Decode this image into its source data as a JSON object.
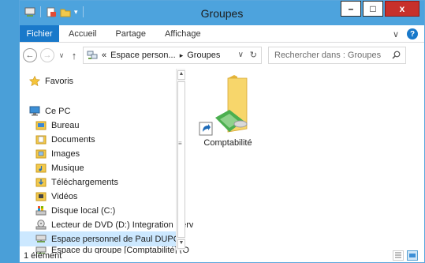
{
  "window": {
    "title": "Groupes",
    "controls": {
      "minimize": "–",
      "maximize": "□",
      "close": "x"
    }
  },
  "ribbon": {
    "file_tab": "Fichier",
    "tabs": [
      "Accueil",
      "Partage",
      "Affichage"
    ],
    "expand_glyph": "∨",
    "help_glyph": "?"
  },
  "address_bar": {
    "back_glyph": "←",
    "forward_glyph": "→",
    "history_glyph": "∨",
    "up_glyph": "↑",
    "overflow": "«",
    "segments": [
      "Espace person...",
      "Groupes"
    ],
    "separator": "▸",
    "dropdown_glyph": "∨",
    "refresh_glyph": "↻"
  },
  "search": {
    "placeholder": "Rechercher dans : Groupes"
  },
  "nav_pane": {
    "items": [
      {
        "label": "Favoris",
        "icon": "star-icon"
      },
      {
        "label": "Ce PC",
        "icon": "computer-icon"
      },
      {
        "label": "Bureau",
        "icon": "desktop-folder-icon"
      },
      {
        "label": "Documents",
        "icon": "documents-folder-icon"
      },
      {
        "label": "Images",
        "icon": "pictures-folder-icon"
      },
      {
        "label": "Musique",
        "icon": "music-folder-icon"
      },
      {
        "label": "Téléchargements",
        "icon": "downloads-folder-icon"
      },
      {
        "label": "Vidéos",
        "icon": "videos-folder-icon"
      },
      {
        "label": "Disque local (C:)",
        "icon": "local-disk-icon"
      },
      {
        "label": "Lecteur de DVD (D:) Integration Serv",
        "icon": "dvd-drive-icon"
      },
      {
        "label": "Espace personnel de Paul DUPONT (",
        "icon": "network-drive-icon",
        "selected": true
      },
      {
        "label": "Espace du groupe [Comptabilité] (O",
        "icon": "network-drive-icon"
      }
    ]
  },
  "content": {
    "items": [
      {
        "label": "Comptabilité",
        "icon": "folder-shortcut-icon"
      }
    ]
  },
  "status_bar": {
    "count": "1 élément"
  },
  "colors": {
    "title_bar": "#4da3dd",
    "file_tab": "#1979ca",
    "close_button": "#c7302b",
    "selection": "#cce8ff",
    "folder": "#f2c94c"
  }
}
